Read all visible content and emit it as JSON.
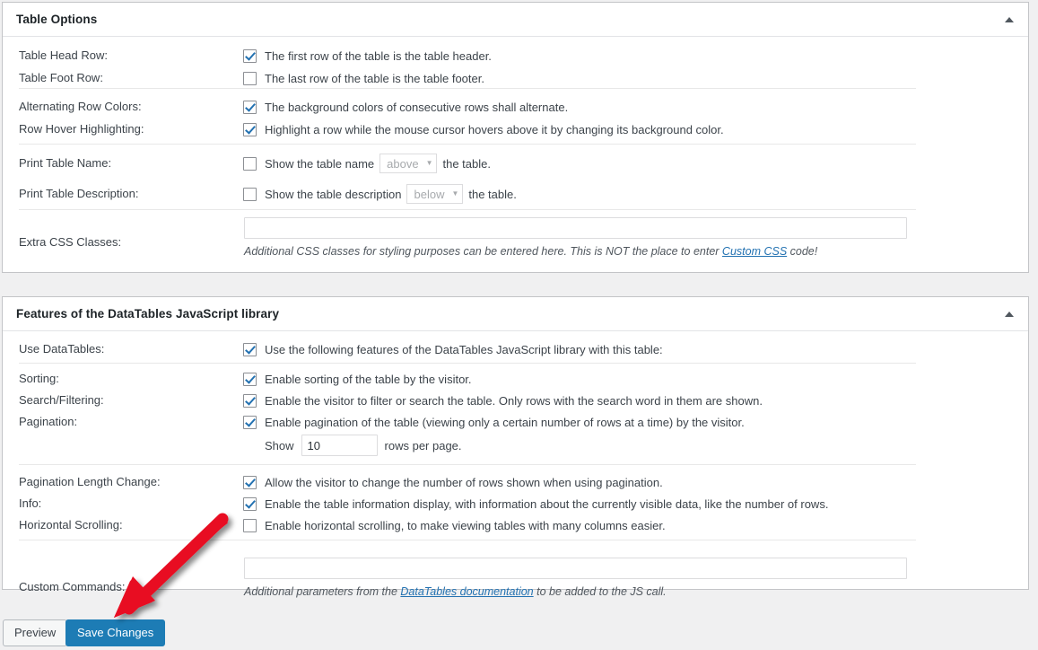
{
  "panels": [
    {
      "id": "table-options",
      "title": "Table Options",
      "toggle_icon": "chevron-up-icon",
      "rows": [
        {
          "label": "Table Head Row:",
          "checked": true,
          "text": "The first row of the table is the table header."
        },
        {
          "label": "Table Foot Row:",
          "checked": false,
          "text": "The last row of the table is the table footer."
        },
        {
          "label": "Alternating Row Colors:",
          "checked": true,
          "text": "The background colors of consecutive rows shall alternate."
        },
        {
          "label": "Row Hover Highlighting:",
          "checked": true,
          "text": "Highlight a row while the mouse cursor hovers above it by changing its background color."
        },
        {
          "label": "Print Table Name:",
          "checked": false,
          "text_before": "Show the table name",
          "select_value": "above",
          "text_after": "the table."
        },
        {
          "label": "Print Table Description:",
          "checked": false,
          "text_before": "Show the table description",
          "select_value": "below",
          "text_after": "the table."
        },
        {
          "label": "Extra CSS Classes:",
          "input_value": "",
          "input_placeholder": ""
        }
      ],
      "extra_css_desc_before": "Additional CSS classes for styling purposes can be entered here. This is NOT the place to enter ",
      "extra_css_desc_link": "Custom CSS",
      "extra_css_desc_after": " code!"
    },
    {
      "id": "datatables",
      "title": "Features of the DataTables JavaScript library",
      "toggle_icon": "chevron-up-icon",
      "rows": [
        {
          "label": "Use DataTables:",
          "checked": true,
          "text": "Use the following features of the DataTables JavaScript library with this table:"
        },
        {
          "label": "Sorting:",
          "checked": true,
          "text": "Enable sorting of the table by the visitor."
        },
        {
          "label": "Search/Filtering:",
          "checked": true,
          "text": "Enable the visitor to filter or search the table. Only rows with the search word in them are shown."
        },
        {
          "label": "Pagination:",
          "checked": true,
          "text": "Enable pagination of the table (viewing only a certain number of rows at a time) by the visitor."
        },
        {
          "label": "",
          "show_prefix": "Show",
          "rows_per_page": "10",
          "show_suffix": "rows per page."
        },
        {
          "label": "Pagination Length Change:",
          "checked": true,
          "text": "Allow the visitor to change the number of rows shown when using pagination."
        },
        {
          "label": "Info:",
          "checked": true,
          "text": "Enable the table information display, with information about the currently visible data, like the number of rows."
        },
        {
          "label": "Horizontal Scrolling:",
          "checked": false,
          "text": "Enable horizontal scrolling, to make viewing tables with many columns easier."
        },
        {
          "label": "Custom Commands:",
          "input_value": "",
          "input_placeholder": ""
        }
      ],
      "custom_cmd_desc_before": "Additional parameters from the ",
      "custom_cmd_desc_link": "DataTables documentation",
      "custom_cmd_desc_after": " to be added to the JS call."
    }
  ],
  "footer": {
    "preview_label": "Preview",
    "save_label": "Save Changes"
  },
  "annotation": {
    "name": "red-arrow-pointing-to-save-changes",
    "color": "#e81123"
  },
  "colors": {
    "accent": "#2271b1",
    "save_button": "#1d7cb5",
    "page_background": "#f0f0f1",
    "panel_background": "#ffffff",
    "panel_border": "#c3c4c7",
    "link": "#2271b1",
    "arrow": "#e81123"
  }
}
